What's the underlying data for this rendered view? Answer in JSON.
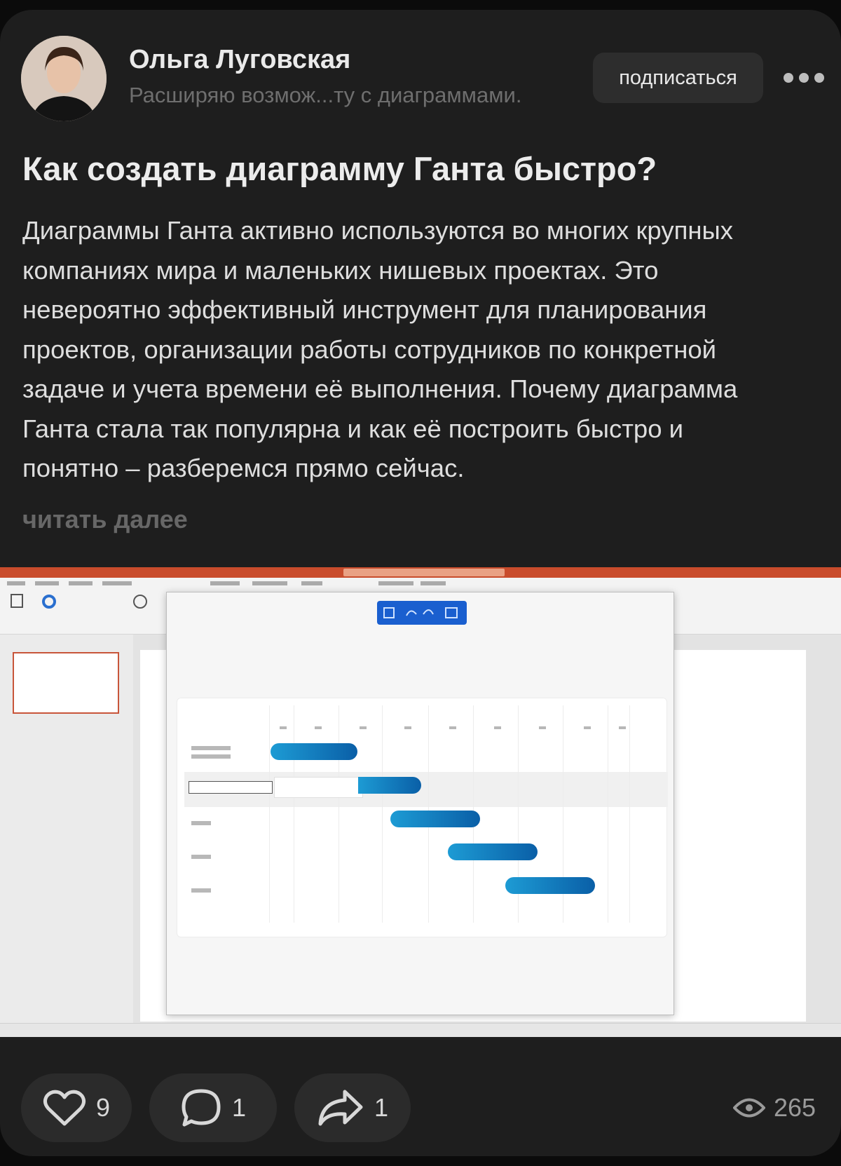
{
  "post": {
    "author": {
      "name": "Ольга Луговская",
      "description": "Расширяю возмож...ту с диаграммами."
    },
    "subscribe_label": "подписаться",
    "title": "Как создать диаграмму Ганта быстро?",
    "body_lines": [
      "Диаграммы Ганта активно используются во многих крупных",
      "компаниях мира и маленьких нишевых проектах. Это",
      "невероятно эффективный инструмент для планирования",
      "проектов, организации работы сотрудников по конкретной",
      "задаче и учета времени её выполнения. Почему диаграмма",
      "Ганта стала так популярна и как её построить быстро и",
      "понятно – разберемся прямо сейчас."
    ],
    "read_more": "читать далее"
  },
  "screenshot": {
    "icon": "powerpoint-gantt-screenshot",
    "accent_color": "#c94c2c",
    "bar_color": "#1a8fcf"
  },
  "actions": {
    "likes": "9",
    "comments": "1",
    "shares": "1",
    "views": "265"
  },
  "icons": {
    "like": "heart-icon",
    "comment": "comment-icon",
    "share": "share-arrow-icon",
    "views": "eye-icon",
    "more": "more-dots-icon"
  }
}
